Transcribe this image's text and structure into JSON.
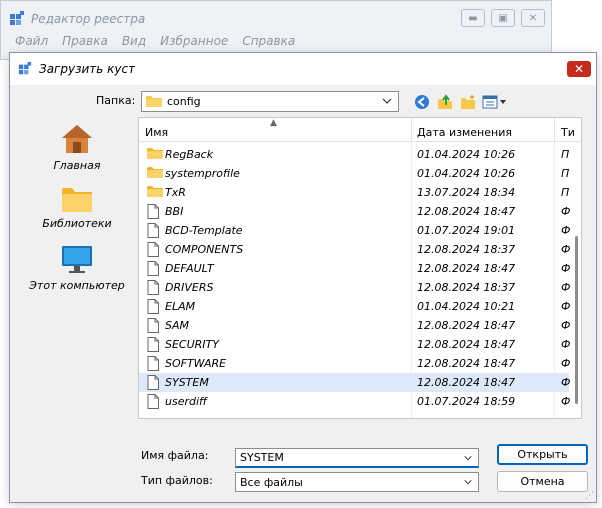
{
  "background_window": {
    "title": "Редактор реестра",
    "menu": [
      "Файл",
      "Правка",
      "Вид",
      "Избранное",
      "Справка"
    ]
  },
  "dialog": {
    "title": "Загрузить куст",
    "look_in": {
      "label": "Папка:",
      "value": "config"
    },
    "toolbar_icons": [
      "back-icon",
      "up-folder-icon",
      "new-folder-icon",
      "view-menu-icon"
    ],
    "places": [
      {
        "label": "Главная",
        "icon": "home-icon"
      },
      {
        "label": "Библиотеки",
        "icon": "libraries-icon"
      },
      {
        "label": "Этот компьютер",
        "icon": "computer-icon"
      }
    ],
    "columns": {
      "name": "Имя",
      "date": "Дата изменения",
      "type": "Ти"
    },
    "files": [
      {
        "name": "RegBack",
        "date": "01.04.2024 10:26",
        "type": "П",
        "kind": "folder",
        "selected": false
      },
      {
        "name": "systemprofile",
        "date": "01.04.2024 10:26",
        "type": "П",
        "kind": "folder",
        "selected": false
      },
      {
        "name": "TxR",
        "date": "13.07.2024 18:34",
        "type": "П",
        "kind": "folder",
        "selected": false
      },
      {
        "name": "BBI",
        "date": "12.08.2024 18:47",
        "type": "Ф",
        "kind": "file",
        "selected": false
      },
      {
        "name": "BCD-Template",
        "date": "01.07.2024 19:01",
        "type": "Ф",
        "kind": "file",
        "selected": false
      },
      {
        "name": "COMPONENTS",
        "date": "12.08.2024 18:37",
        "type": "Ф",
        "kind": "file",
        "selected": false
      },
      {
        "name": "DEFAULT",
        "date": "12.08.2024 18:47",
        "type": "Ф",
        "kind": "file",
        "selected": false
      },
      {
        "name": "DRIVERS",
        "date": "12.08.2024 18:37",
        "type": "Ф",
        "kind": "file",
        "selected": false
      },
      {
        "name": "ELAM",
        "date": "01.04.2024 10:21",
        "type": "Ф",
        "kind": "file",
        "selected": false
      },
      {
        "name": "SAM",
        "date": "12.08.2024 18:47",
        "type": "Ф",
        "kind": "file",
        "selected": false
      },
      {
        "name": "SECURITY",
        "date": "12.08.2024 18:47",
        "type": "Ф",
        "kind": "file",
        "selected": false
      },
      {
        "name": "SOFTWARE",
        "date": "12.08.2024 18:47",
        "type": "Ф",
        "kind": "file",
        "selected": false
      },
      {
        "name": "SYSTEM",
        "date": "12.08.2024 18:47",
        "type": "Ф",
        "kind": "file",
        "selected": true
      },
      {
        "name": "userdiff",
        "date": "01.07.2024 18:59",
        "type": "Ф",
        "kind": "file",
        "selected": false
      }
    ],
    "file_name": {
      "label": "Имя файла:",
      "value": "SYSTEM"
    },
    "file_type": {
      "label": "Тип файлов:",
      "value": "Все файлы"
    },
    "buttons": {
      "open": "Открыть",
      "cancel": "Отмена"
    },
    "colors": {
      "accent": "#0067c0",
      "selection": "#dbe9f8",
      "close": "#c42b1c",
      "folder": "#f8c848"
    }
  }
}
